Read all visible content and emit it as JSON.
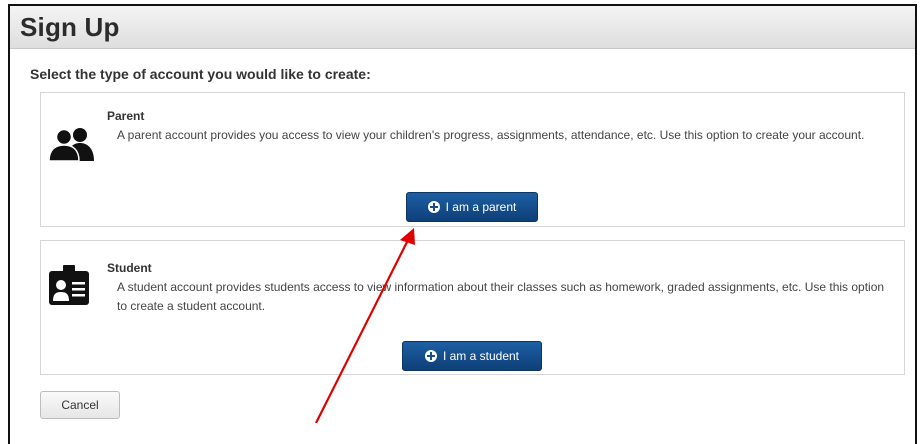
{
  "header": {
    "title": "Sign Up"
  },
  "prompt": "Select the type of account you would like to create:",
  "cards": {
    "parent": {
      "title": "Parent",
      "description": "A parent account provides you access to view your children's progress, assignments, attendance, etc. Use this option to create your account.",
      "button_label": "I am a parent",
      "icon": "parents-icon"
    },
    "student": {
      "title": "Student",
      "description": "A student account provides students access to view information about their classes such as homework, graded assignments, etc. Use this option to create a student account.",
      "button_label": "I am a student",
      "icon": "student-id-badge-icon"
    }
  },
  "cancel_label": "Cancel",
  "colors": {
    "primary_button": "#154f8f",
    "annotation_arrow": "#e00000",
    "header_bg": "#e6e6e6"
  }
}
